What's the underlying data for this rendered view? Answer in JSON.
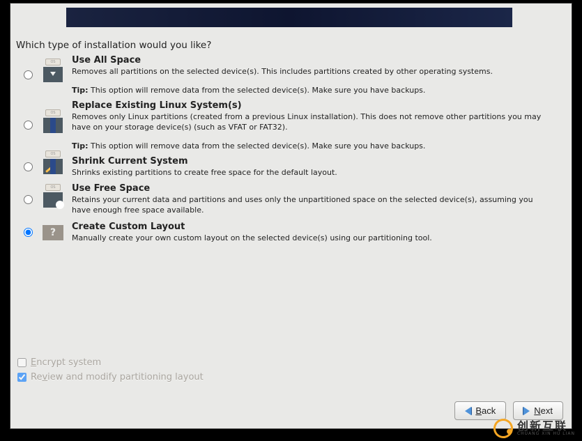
{
  "question": "Which type of installation would you like?",
  "options": [
    {
      "title": "Use All Space",
      "desc": "Removes all partitions on the selected device(s).  This includes partitions created by other operating systems.",
      "tip_label": "Tip:",
      "tip_text": " This option will remove data from the selected device(s).  Make sure you have backups."
    },
    {
      "title": "Replace Existing Linux System(s)",
      "desc": "Removes only Linux partitions (created from a previous Linux installation).  This does not remove other partitions you may have on your storage device(s) (such as VFAT or FAT32).",
      "tip_label": "Tip:",
      "tip_text": " This option will remove data from the selected device(s).  Make sure you have backups."
    },
    {
      "title": "Shrink Current System",
      "desc": "Shrinks existing partitions to create free space for the default layout."
    },
    {
      "title": "Use Free Space",
      "desc": "Retains your current data and partitions and uses only the unpartitioned space on the selected device(s), assuming you have enough free space available."
    },
    {
      "title": "Create Custom Layout",
      "desc": "Manually create your own custom layout on the selected device(s) using our partitioning tool."
    }
  ],
  "selected_option_index": 4,
  "checkboxes": {
    "encrypt": {
      "mnemonic": "E",
      "rest": "ncrypt system",
      "checked": false
    },
    "review": {
      "pre": "Re",
      "mnemonic": "v",
      "rest": "iew and modify partitioning layout",
      "checked": true
    }
  },
  "buttons": {
    "back": {
      "mnemonic": "B",
      "rest": "ack"
    },
    "next": {
      "mnemonic": "N",
      "rest": "ext"
    }
  },
  "watermark": {
    "cn": "创新互联",
    "en": "CHUANG XIN HU LIAN"
  }
}
